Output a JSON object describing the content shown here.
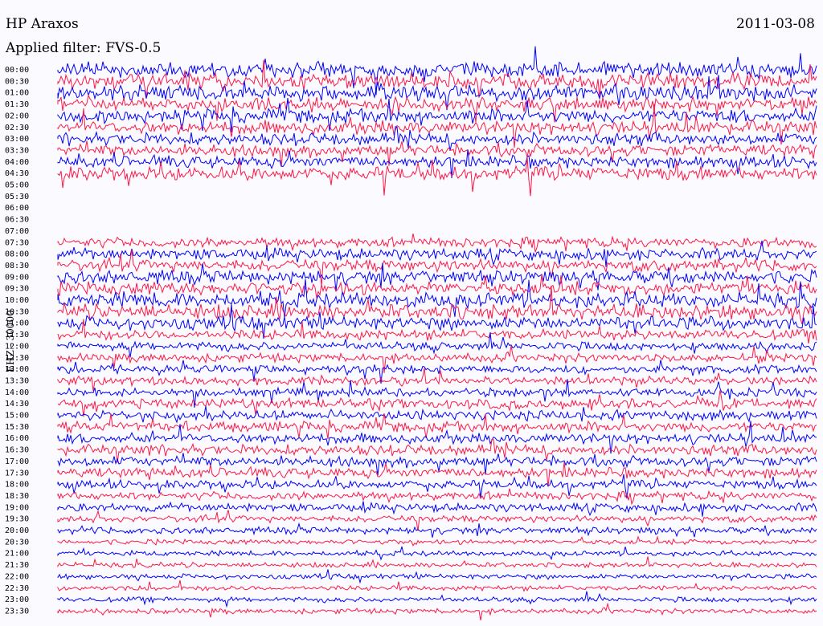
{
  "header": {
    "station": "HP Araxos",
    "filter": "Applied filter: FVS-0.5",
    "date": "2011-03-08",
    "channel": "EHZ - 30000"
  },
  "colors": {
    "trace_a": "#0000ff",
    "trace_b": "#ff1744",
    "background": "#fbfbff"
  },
  "chart_data": {
    "type": "line",
    "title": "HP Araxos",
    "date": "2011-03-08",
    "ylabel": "EHZ - 30000",
    "row_labels": [
      "00:00",
      "00:30",
      "01:00",
      "01:30",
      "02:00",
      "02:30",
      "03:00",
      "03:30",
      "04:00",
      "04:30",
      "05:00",
      "05:30",
      "06:00",
      "06:30",
      "07:00",
      "07:30",
      "08:00",
      "08:30",
      "09:00",
      "09:30",
      "10:00",
      "10:30",
      "11:00",
      "11:30",
      "12:00",
      "12:30",
      "13:00",
      "13:30",
      "14:00",
      "14:30",
      "15:00",
      "15:30",
      "16:00",
      "16:30",
      "17:00",
      "17:30",
      "18:00",
      "18:30",
      "19:00",
      "19:30",
      "20:00",
      "20:30",
      "21:00",
      "21:30",
      "22:00",
      "22:30",
      "23:00",
      "23:30"
    ],
    "trace_colors_alternating": [
      "#0000ff",
      "#ff1744"
    ],
    "rows": [
      {
        "t": "00:00",
        "amp": 9
      },
      {
        "t": "00:30",
        "amp": 9
      },
      {
        "t": "01:00",
        "amp": 9
      },
      {
        "t": "01:30",
        "amp": 8
      },
      {
        "t": "02:00",
        "amp": 8
      },
      {
        "t": "02:30",
        "amp": 8
      },
      {
        "t": "03:00",
        "amp": 7
      },
      {
        "t": "03:30",
        "amp": 7
      },
      {
        "t": "04:00",
        "amp": 7
      },
      {
        "t": "04:30",
        "amp": 8
      },
      {
        "t": "05:00",
        "amp": 0
      },
      {
        "t": "05:30",
        "amp": 0
      },
      {
        "t": "06:00",
        "amp": 0
      },
      {
        "t": "06:30",
        "amp": 0
      },
      {
        "t": "07:00",
        "amp": 0
      },
      {
        "t": "07:30",
        "amp": 6
      },
      {
        "t": "08:00",
        "amp": 7
      },
      {
        "t": "08:30",
        "amp": 7
      },
      {
        "t": "09:00",
        "amp": 8
      },
      {
        "t": "09:30",
        "amp": 8
      },
      {
        "t": "10:00",
        "amp": 9
      },
      {
        "t": "10:30",
        "amp": 9
      },
      {
        "t": "11:00",
        "amp": 8
      },
      {
        "t": "11:30",
        "amp": 6
      },
      {
        "t": "12:00",
        "amp": 5
      },
      {
        "t": "12:30",
        "amp": 5
      },
      {
        "t": "13:00",
        "amp": 5
      },
      {
        "t": "13:30",
        "amp": 5
      },
      {
        "t": "14:00",
        "amp": 5
      },
      {
        "t": "14:30",
        "amp": 6
      },
      {
        "t": "15:00",
        "amp": 6
      },
      {
        "t": "15:30",
        "amp": 6
      },
      {
        "t": "16:00",
        "amp": 6
      },
      {
        "t": "16:30",
        "amp": 6
      },
      {
        "t": "17:00",
        "amp": 6
      },
      {
        "t": "17:30",
        "amp": 6
      },
      {
        "t": "18:00",
        "amp": 5
      },
      {
        "t": "18:30",
        "amp": 5
      },
      {
        "t": "19:00",
        "amp": 5
      },
      {
        "t": "19:30",
        "amp": 4
      },
      {
        "t": "20:00",
        "amp": 4
      },
      {
        "t": "20:30",
        "amp": 3
      },
      {
        "t": "21:00",
        "amp": 3
      },
      {
        "t": "21:30",
        "amp": 3
      },
      {
        "t": "22:00",
        "amp": 3
      },
      {
        "t": "22:30",
        "amp": 3
      },
      {
        "t": "23:00",
        "amp": 3
      },
      {
        "t": "23:30",
        "amp": 3
      }
    ]
  }
}
